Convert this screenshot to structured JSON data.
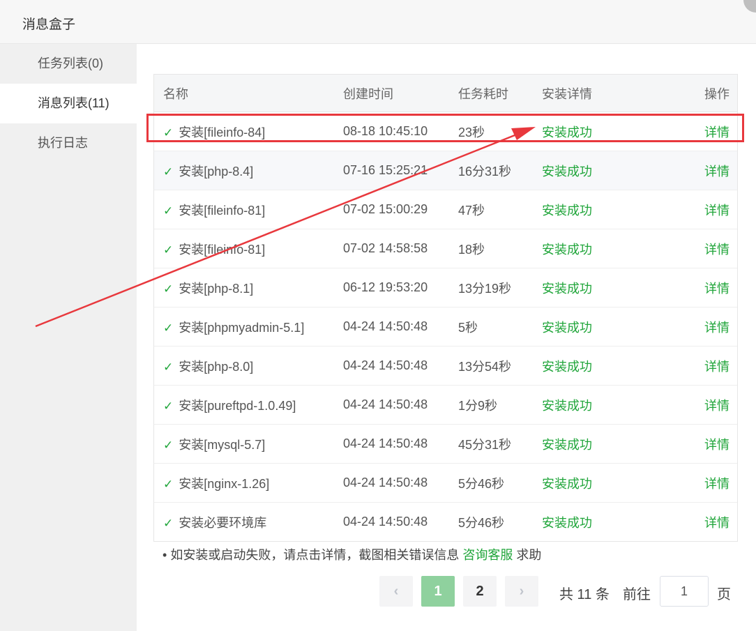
{
  "dialog": {
    "title": "消息盒子"
  },
  "sidebar": {
    "items": [
      {
        "label": "任务列表(0)",
        "active": false
      },
      {
        "label": "消息列表(11)",
        "active": true
      },
      {
        "label": "执行日志",
        "active": false
      }
    ]
  },
  "table": {
    "headers": {
      "name": "名称",
      "created": "创建时间",
      "duration": "任务耗时",
      "status": "安装详情",
      "action": "操作"
    },
    "rows": [
      {
        "name": "安装[fileinfo-84]",
        "created": "08-18 10:45:10",
        "duration": "23秒",
        "status": "安装成功",
        "action": "详情"
      },
      {
        "name": "安装[php-8.4]",
        "created": "07-16 15:25:21",
        "duration": "16分31秒",
        "status": "安装成功",
        "action": "详情"
      },
      {
        "name": "安装[fileinfo-81]",
        "created": "07-02 15:00:29",
        "duration": "47秒",
        "status": "安装成功",
        "action": "详情"
      },
      {
        "name": "安装[fileinfo-81]",
        "created": "07-02 14:58:58",
        "duration": "18秒",
        "status": "安装成功",
        "action": "详情"
      },
      {
        "name": "安装[php-8.1]",
        "created": "06-12 19:53:20",
        "duration": "13分19秒",
        "status": "安装成功",
        "action": "详情"
      },
      {
        "name": "安装[phpmyadmin-5.1]",
        "created": "04-24 14:50:48",
        "duration": "5秒",
        "status": "安装成功",
        "action": "详情"
      },
      {
        "name": "安装[php-8.0]",
        "created": "04-24 14:50:48",
        "duration": "13分54秒",
        "status": "安装成功",
        "action": "详情"
      },
      {
        "name": "安装[pureftpd-1.0.49]",
        "created": "04-24 14:50:48",
        "duration": "1分9秒",
        "status": "安装成功",
        "action": "详情"
      },
      {
        "name": "安装[mysql-5.7]",
        "created": "04-24 14:50:48",
        "duration": "45分31秒",
        "status": "安装成功",
        "action": "详情"
      },
      {
        "name": "安装[nginx-1.26]",
        "created": "04-24 14:50:48",
        "duration": "5分46秒",
        "status": "安装成功",
        "action": "详情"
      },
      {
        "name": "安装必要环境库",
        "created": "04-24 14:50:48",
        "duration": "5分46秒",
        "status": "安装成功",
        "action": "详情"
      }
    ]
  },
  "note": {
    "bullet": "•",
    "text_before": "如安装或启动失败，请点击详情，截图相关错误信息 ",
    "link": "咨询客服",
    "text_after": " 求助"
  },
  "pagination": {
    "prev": "‹",
    "pages": [
      "1",
      "2"
    ],
    "current": "1",
    "next": "›",
    "total": "共 11 条",
    "goto_label": "前往",
    "goto_value": "1",
    "goto_suffix": "页"
  },
  "colors": {
    "accent": "#20a53a",
    "highlight": "#e8383d"
  }
}
